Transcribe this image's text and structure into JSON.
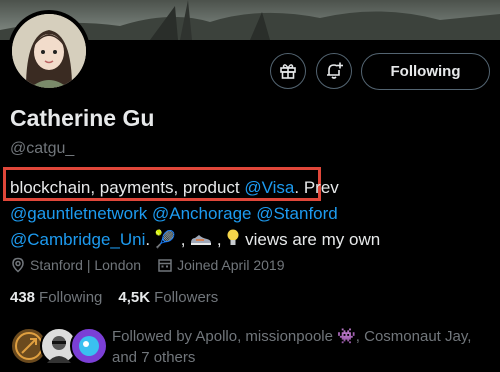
{
  "profile": {
    "name": "Catherine Gu",
    "handle": "@catgu_"
  },
  "actions": {
    "follow_label": "Following"
  },
  "bio": {
    "line1_text": "blockchain, payments, product ",
    "line1_mention": "@Visa",
    "line1_after": ". Prev",
    "line2_mentions": "@gauntletnetwork @Anchorage @Stanford",
    "line3_mention": "@Cambridge_Uni",
    "line3_mid": ". 🎾 ,",
    "line3_sep": " ,",
    "line3_tail": " views are my own"
  },
  "meta": {
    "location": "Stanford | London",
    "joined": "Joined April 2019"
  },
  "stats": {
    "following_count": "438",
    "following_label": "Following",
    "followers_count": "4,5K",
    "followers_label": "Followers"
  },
  "followed_by": "Followed by Apollo, missionpoole 👾, Cosmonaut Jay, and 7 others",
  "icons": {
    "location": "location-pin-icon",
    "calendar": "calendar-icon",
    "gift": "gift-icon",
    "notify": "bell-plus-icon"
  },
  "colors": {
    "link": "#1d9bf0",
    "highlight_border": "#e0473a",
    "secondary_text": "#71767b"
  }
}
